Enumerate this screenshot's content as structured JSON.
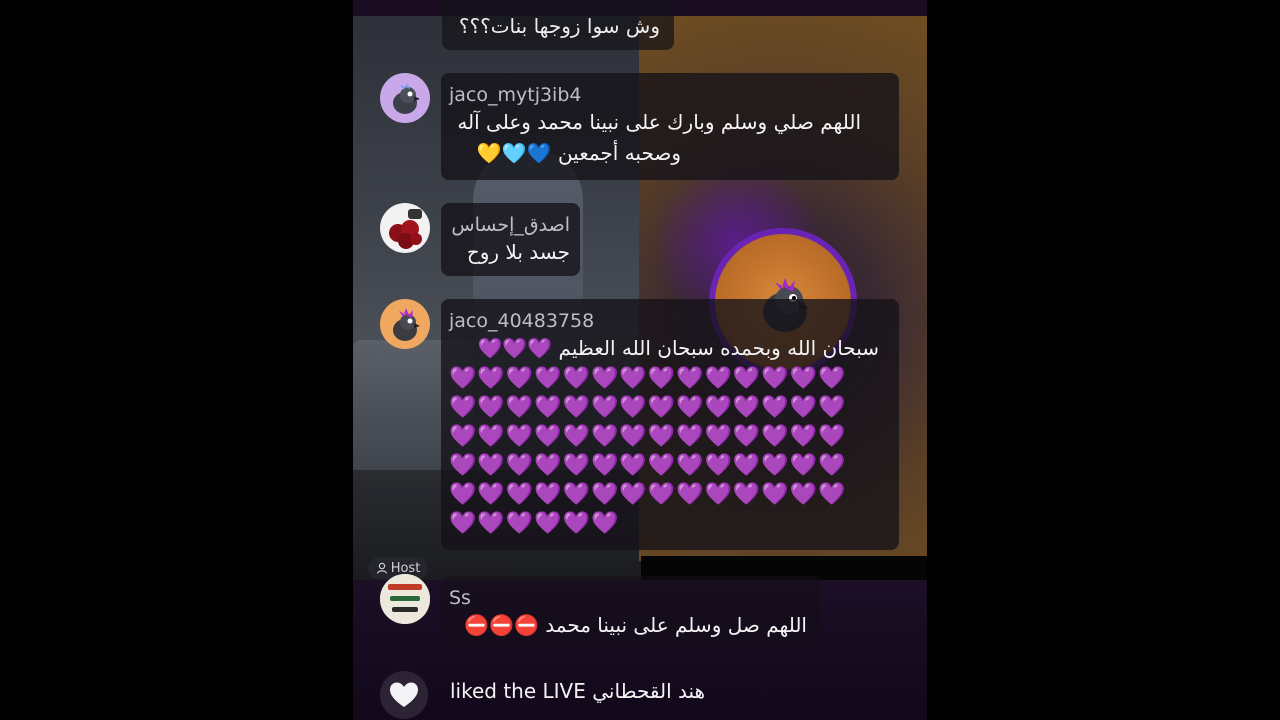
{
  "comments": [
    {
      "id": "top",
      "text": "وش سوا زوجها بنات؟؟؟"
    },
    {
      "id": "c1",
      "username": "jaco_mytj3ib4",
      "text_line1": "اللهم صلي وسلم وبارك على نبينا محمد وعلى آله",
      "text_line2": "وصحبه أجمعين 💙🩵💛"
    },
    {
      "id": "c2",
      "username": "اصدق_إحساس",
      "text": "جسد بلا روح"
    },
    {
      "id": "c3",
      "username": "jaco_40483758",
      "text": "سبحان الله وبحمده سبحان الله العظيم 💜💜💜",
      "heart_rows": [
        "💜💜💜💜💜💜💜💜💜💜💜💜💜💜",
        "💜💜💜💜💜💜💜💜💜💜💜💜💜💜",
        "💜💜💜💜💜💜💜💜💜💜💜💜💜💜",
        "💜💜💜💜💜💜💜💜💜💜💜💜💜💜",
        "💜💜💜💜💜💜💜💜💜💜💜💜💜💜",
        "💜💜💜💜💜💜"
      ]
    },
    {
      "id": "c4",
      "username": "Ss",
      "badge": "Host",
      "text": "اللهم صل وسلم على نبينا محمد ⛔⛔⛔"
    }
  ],
  "liked": {
    "text": "liked the LIVE هند القحطاني"
  },
  "colors": {
    "background": "#000000",
    "bubble": "#141218",
    "purple_ring": "#6a24b4",
    "heart": "#b43cdc"
  }
}
